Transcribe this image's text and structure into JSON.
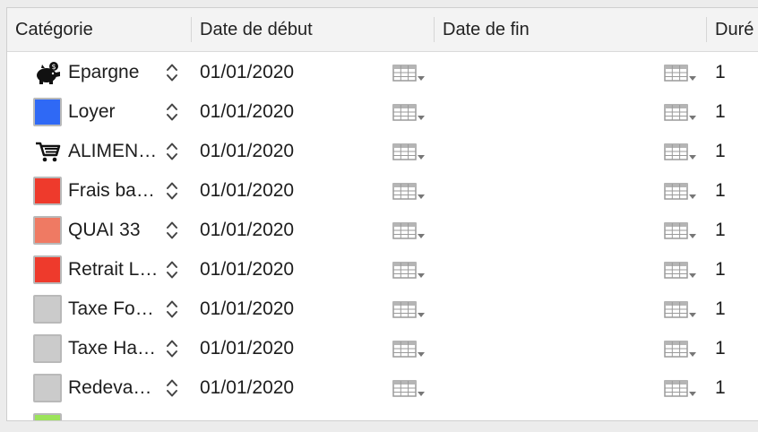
{
  "columns": {
    "category": "Catégorie",
    "start_date": "Date de début",
    "end_date": "Date de fin",
    "duration": "Duré"
  },
  "rows": [
    {
      "icon": "piggy-bank-icon",
      "label": "Epargne",
      "start": "01/01/2020",
      "end": "",
      "duration": "1"
    },
    {
      "icon": "color-swatch",
      "color": "#2f69f5",
      "label": "Loyer",
      "start": "01/01/2020",
      "end": "",
      "duration": "1"
    },
    {
      "icon": "shopping-cart-icon",
      "label": "ALIMEN…",
      "start": "01/01/2020",
      "end": "",
      "duration": "1"
    },
    {
      "icon": "color-swatch",
      "color": "#ee3a2c",
      "label": "Frais ba…",
      "start": "01/01/2020",
      "end": "",
      "duration": "1"
    },
    {
      "icon": "color-swatch",
      "color": "#ef7a63",
      "label": "QUAI 33",
      "start": "01/01/2020",
      "end": "",
      "duration": "1"
    },
    {
      "icon": "color-swatch",
      "color": "#ee3a2c",
      "label": "Retrait L…",
      "start": "01/01/2020",
      "end": "",
      "duration": "1"
    },
    {
      "icon": "color-swatch",
      "color": "#cbcbcb",
      "label": "Taxe Fo…",
      "start": "01/01/2020",
      "end": "",
      "duration": "1"
    },
    {
      "icon": "color-swatch",
      "color": "#cbcbcb",
      "label": "Taxe Ha…",
      "start": "01/01/2020",
      "end": "",
      "duration": "1"
    },
    {
      "icon": "color-swatch",
      "color": "#cbcbcb",
      "label": "Redeva…",
      "start": "01/01/2020",
      "end": "",
      "duration": "1"
    },
    {
      "icon": "color-swatch",
      "color": "#9be35a",
      "label": "",
      "start": "",
      "end": "",
      "duration": ""
    }
  ]
}
